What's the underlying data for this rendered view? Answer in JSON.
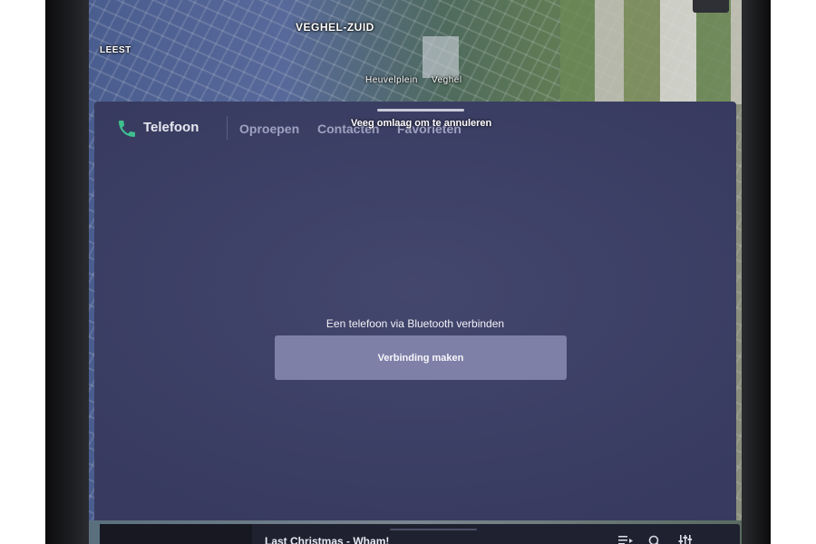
{
  "map": {
    "labels": {
      "leest": "LEEST",
      "veghel_zuid": "VEGHEL-ZUID",
      "heuvelplein": "Heuvelplein",
      "veghel": "Veghel"
    }
  },
  "phone_app": {
    "title": "Telefoon",
    "icon": "phone-icon",
    "accent_color": "#3fbf8f",
    "tabs": [
      {
        "label": "Oproepen"
      },
      {
        "label": "Contacten"
      },
      {
        "label": "Favorieten"
      }
    ],
    "swipe_hint": "Veeg omlaag om te annuleren",
    "message": "Een telefoon via Bluetooth verbinden",
    "connect_button": "Verbinding maken"
  },
  "media": {
    "song": "Last Christmas - Wham!",
    "icons": [
      "playlist-icon",
      "search-icon",
      "equalizer-icon"
    ]
  }
}
